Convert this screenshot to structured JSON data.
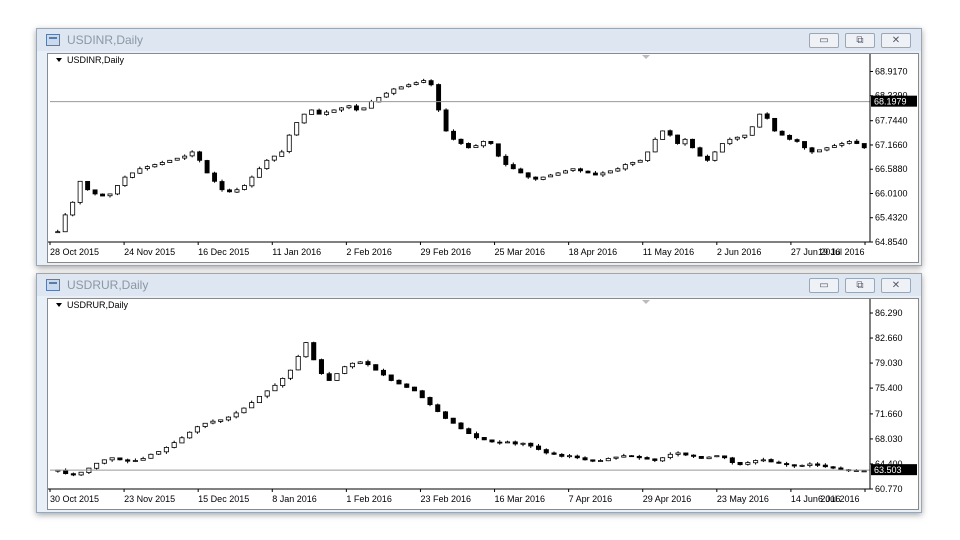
{
  "windows": [
    {
      "title": "USDINR,Daily",
      "chart_label": "USDINR,Daily",
      "buttons": {
        "minimize": "▭",
        "restore": "⧉",
        "close": "✕"
      },
      "chart_data": {
        "type": "candlestick",
        "symbol": "USDINR",
        "timeframe": "Daily",
        "current_price": "68.1979",
        "current_value": 68.1979,
        "ylim": [
          64.854,
          69.0
        ],
        "y_ticks": [
          "68.9170",
          "68.3390",
          "67.7440",
          "67.1660",
          "66.5880",
          "66.0100",
          "65.4320",
          "64.8540"
        ],
        "y_tick_values": [
          68.917,
          68.339,
          67.744,
          67.166,
          66.588,
          66.01,
          65.432,
          64.854
        ],
        "x_ticks": [
          "28 Oct 2015",
          "24 Nov 2015",
          "16 Dec 2015",
          "11 Jan 2016",
          "2 Feb 2016",
          "29 Feb 2016",
          "25 Mar 2016",
          "18 Apr 2016",
          "11 May 2016",
          "2 Jun 2016",
          "27 Jun 2016",
          "19 Jul 2016"
        ],
        "close_series": [
          65.1,
          65.5,
          65.8,
          66.3,
          66.1,
          66.0,
          65.95,
          66.0,
          66.2,
          66.4,
          66.5,
          66.6,
          66.65,
          66.7,
          66.75,
          66.8,
          66.85,
          66.9,
          67.0,
          66.8,
          66.5,
          66.3,
          66.1,
          66.05,
          66.1,
          66.2,
          66.4,
          66.6,
          66.8,
          66.9,
          67.0,
          67.4,
          67.7,
          67.9,
          68.0,
          67.9,
          67.95,
          68.0,
          68.05,
          68.1,
          68.0,
          68.05,
          68.2,
          68.3,
          68.4,
          68.5,
          68.55,
          68.6,
          68.65,
          68.7,
          68.6,
          68.0,
          67.5,
          67.3,
          67.2,
          67.1,
          67.15,
          67.25,
          67.2,
          66.9,
          66.7,
          66.6,
          66.5,
          66.4,
          66.35,
          66.4,
          66.45,
          66.5,
          66.55,
          66.6,
          66.55,
          66.5,
          66.45,
          66.5,
          66.55,
          66.6,
          66.7,
          66.75,
          66.8,
          67.0,
          67.3,
          67.5,
          67.4,
          67.2,
          67.3,
          67.1,
          66.9,
          66.8,
          67.0,
          67.2,
          67.3,
          67.35,
          67.4,
          67.6,
          67.9,
          67.8,
          67.5,
          67.4,
          67.3,
          67.25,
          67.1,
          67.0,
          67.05,
          67.1,
          67.15,
          67.2,
          67.25,
          67.2,
          67.1
        ]
      }
    },
    {
      "title": "USDRUR,Daily",
      "chart_label": "USDRUR,Daily",
      "buttons": {
        "minimize": "▭",
        "restore": "⧉",
        "close": "✕"
      },
      "chart_data": {
        "type": "candlestick",
        "symbol": "USDRUR",
        "timeframe": "Daily",
        "current_price": "63.503",
        "current_value": 63.503,
        "ylim": [
          60.77,
          86.29
        ],
        "y_ticks": [
          "86.290",
          "82.660",
          "79.030",
          "75.400",
          "71.660",
          "68.030",
          "64.400",
          "60.770"
        ],
        "y_tick_values": [
          86.29,
          82.66,
          79.03,
          75.4,
          71.66,
          68.03,
          64.4,
          60.77
        ],
        "x_ticks": [
          "30 Oct 2015",
          "23 Nov 2015",
          "15 Dec 2015",
          "8 Jan 2016",
          "1 Feb 2016",
          "23 Feb 2016",
          "16 Mar 2016",
          "7 Apr 2016",
          "29 Apr 2016",
          "23 May 2016",
          "14 Jun 2016",
          "6 Jul 2016"
        ],
        "close_series": [
          63.5,
          63.0,
          62.8,
          63.2,
          63.8,
          64.5,
          65.0,
          65.3,
          65.0,
          64.8,
          64.9,
          65.2,
          65.8,
          66.2,
          66.8,
          67.5,
          68.2,
          69.0,
          69.8,
          70.3,
          70.6,
          70.8,
          71.2,
          71.8,
          72.5,
          73.3,
          74.2,
          75.0,
          75.8,
          76.8,
          78.0,
          80.0,
          82.0,
          79.5,
          77.5,
          76.5,
          77.5,
          78.5,
          79.0,
          79.2,
          78.8,
          78.0,
          77.3,
          76.5,
          76.0,
          75.5,
          75.0,
          74.0,
          73.0,
          72.0,
          71.0,
          70.3,
          69.5,
          68.8,
          68.2,
          67.9,
          67.6,
          67.5,
          67.6,
          67.3,
          67.4,
          67.0,
          66.5,
          66.0,
          65.8,
          65.5,
          65.6,
          65.3,
          65.0,
          64.8,
          64.9,
          65.2,
          65.4,
          65.6,
          65.5,
          65.3,
          65.1,
          64.9,
          65.3,
          65.8,
          66.0,
          65.7,
          65.5,
          65.2,
          65.4,
          65.6,
          65.3,
          64.6,
          64.3,
          64.6,
          64.9,
          65.0,
          64.7,
          64.5,
          64.3,
          64.1,
          64.2,
          64.4,
          64.2,
          64.0,
          63.8,
          63.6,
          63.5,
          63.4,
          63.4
        ]
      }
    }
  ]
}
